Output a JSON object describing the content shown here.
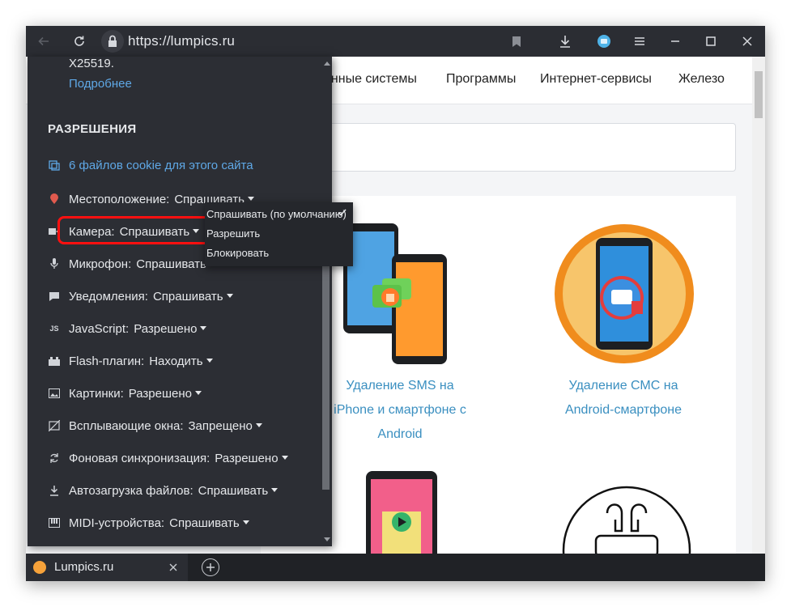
{
  "browser": {
    "url": "https://lumpics.ru",
    "icons": [
      "back-icon",
      "reload-icon",
      "lock-icon",
      "bookmark-icon",
      "download-icon",
      "alice-icon",
      "menu-icon",
      "minimize-icon",
      "maximize-icon",
      "close-icon"
    ]
  },
  "site": {
    "nav": [
      "онные системы",
      "Программы",
      "Интернет-сервисы",
      "Железо"
    ],
    "cards": [
      {
        "title_lines": [
          "Удаление SMS на",
          "iPhone и смартфоне с",
          "Android"
        ]
      },
      {
        "title_lines": [
          "Удаление СМС на",
          "Android-смартфоне"
        ]
      }
    ]
  },
  "panel": {
    "cert_text": "X25519.",
    "more_link": "Подробнее",
    "permissions_heading": "РАЗРЕШЕНИЯ",
    "cookies_link": "6 файлов cookie для этого сайта",
    "permissions": [
      {
        "label": "Местоположение:",
        "value": "Спрашивать",
        "icon": "location-icon"
      },
      {
        "label": "Камера:",
        "value": "Спрашивать",
        "icon": "camera-icon"
      },
      {
        "label": "Микрофон:",
        "value": "Спрашивать",
        "icon": "microphone-icon"
      },
      {
        "label": "Уведомления:",
        "value": "Спрашивать",
        "icon": "notifications-icon"
      },
      {
        "label": "JavaScript:",
        "value": "Разрешено",
        "icon": "javascript-icon"
      },
      {
        "label": "Flash-плагин:",
        "value": "Находить",
        "icon": "plugin-icon"
      },
      {
        "label": "Картинки:",
        "value": "Разрешено",
        "icon": "image-icon"
      },
      {
        "label": "Всплывающие окна:",
        "value": "Запрещено",
        "icon": "popup-blocked-icon"
      },
      {
        "label": "Фоновая синхронизация:",
        "value": "Разрешено",
        "icon": "sync-icon"
      },
      {
        "label": "Автозагрузка файлов:",
        "value": "Спрашивать",
        "icon": "download-icon"
      },
      {
        "label": "MIDI-устройства:",
        "value": "Спрашивать",
        "icon": "midi-icon"
      }
    ]
  },
  "dropdown": {
    "options": [
      "Спрашивать (по умолчанию)",
      "Разрешить",
      "Блокировать"
    ],
    "selected_index": 0
  },
  "tab": {
    "title": "Lumpics.ru"
  },
  "colors": {
    "highlight": "#ff1010",
    "link": "#5fa8e6",
    "card_title": "#3a8fc0",
    "panel_bg": "#2c2e34"
  }
}
